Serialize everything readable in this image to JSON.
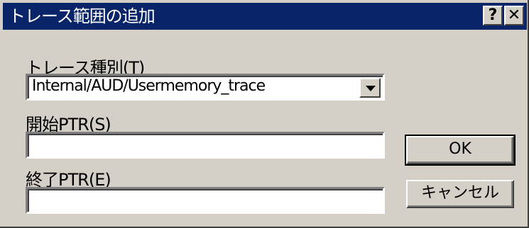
{
  "window": {
    "title": "トレース範囲の追加",
    "help_button": "?",
    "close_button": "✕"
  },
  "trace_type": {
    "label": "トレース種別",
    "accel_open": "(",
    "accel_key": "T",
    "accel_close": ")",
    "value": "Internal/AUD/Usermemory_trace"
  },
  "start_ptr": {
    "label": "開始PTR",
    "accel_open": "(",
    "accel_key": "S",
    "accel_close": ")",
    "value": ""
  },
  "end_ptr": {
    "label": "終了PTR",
    "accel_open": "(",
    "accel_key": "E",
    "accel_close": ")",
    "value": ""
  },
  "buttons": {
    "ok": "OK",
    "cancel": "キャンセル"
  },
  "colors": {
    "titlebar": "#0a246a",
    "face": "#d4d0c8"
  }
}
